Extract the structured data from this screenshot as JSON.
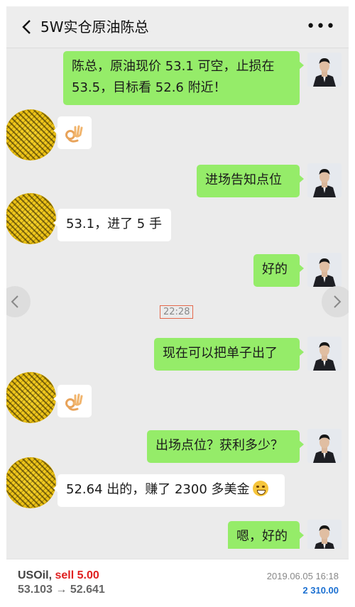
{
  "header": {
    "title": "5W实仓原油陈总",
    "back_icon": "chevron-left-icon",
    "more_label": "•••"
  },
  "messages": [
    {
      "from": "me",
      "lines": [
        "陈总，原油现价 53.1 可空，止损在",
        "53.5，目标看 52.6 附近！"
      ]
    },
    {
      "from": "other",
      "icon": "ok-hand-icon"
    },
    {
      "from": "me",
      "lines": [
        "进场告知点位"
      ]
    },
    {
      "from": "other",
      "lines": [
        "53.1，进了 5 手"
      ]
    },
    {
      "from": "me",
      "lines": [
        "好的"
      ]
    },
    {
      "from": "me",
      "lines": [
        "现在可以把单子出了"
      ]
    },
    {
      "from": "other",
      "icon": "ok-hand-icon"
    },
    {
      "from": "me",
      "lines": [
        "出场点位？获利多少？"
      ]
    },
    {
      "from": "other",
      "lines": [
        "52.64 出的，赚了 2300 多美金"
      ],
      "emoji": "grinning-face-icon"
    },
    {
      "from": "me",
      "lines": [
        "嗯，好的"
      ]
    }
  ],
  "timestamp": "22:28",
  "nav": {
    "prev_icon": "chevron-left-icon",
    "next_icon": "chevron-right-icon"
  },
  "trade": {
    "symbol": "USOil,",
    "side": "sell 5.00",
    "open_price": "53.103",
    "arrow": "→",
    "close_price": "52.641",
    "datetime": "2019.06.05 16:18",
    "profit": "2 310.00"
  },
  "colors": {
    "bubble_me": "#95ec69",
    "bubble_other": "#ffffff",
    "sell": "#e02020",
    "profit": "#1a6fd1",
    "highlight_border": "#e4684a"
  }
}
